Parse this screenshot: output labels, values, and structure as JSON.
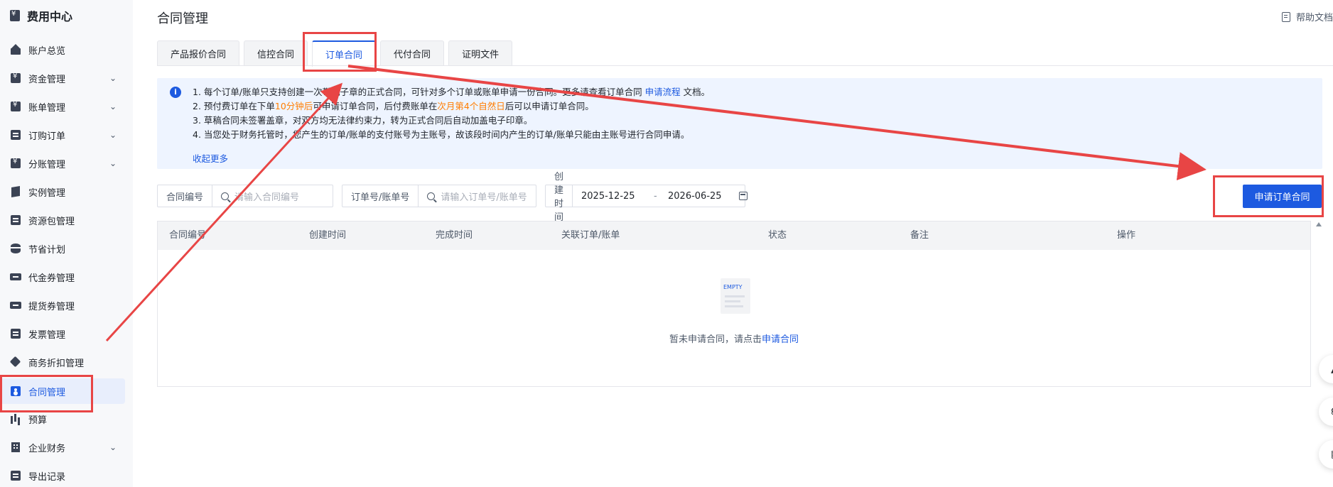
{
  "sidebar": {
    "brand": "费用中心",
    "items": [
      {
        "label": "账户总览",
        "icon": "house-icon",
        "chevron": false
      },
      {
        "label": "资金管理",
        "icon": "fund-icon",
        "chevron": true
      },
      {
        "label": "账单管理",
        "icon": "bill-icon",
        "chevron": true
      },
      {
        "label": "订购订单",
        "icon": "order-icon",
        "chevron": true
      },
      {
        "label": "分账管理",
        "icon": "split-icon",
        "chevron": true
      },
      {
        "label": "实例管理",
        "icon": "cube-icon",
        "chevron": false
      },
      {
        "label": "资源包管理",
        "icon": "package-icon",
        "chevron": false
      },
      {
        "label": "节省计划",
        "icon": "database-icon",
        "chevron": false
      },
      {
        "label": "代金券管理",
        "icon": "voucher-icon",
        "chevron": false
      },
      {
        "label": "提货券管理",
        "icon": "coupon-icon",
        "chevron": false
      },
      {
        "label": "发票管理",
        "icon": "invoice-icon",
        "chevron": false
      },
      {
        "label": "商务折扣管理",
        "icon": "tag-icon",
        "chevron": false
      },
      {
        "label": "合同管理",
        "icon": "contract-icon",
        "chevron": false,
        "active": true
      },
      {
        "label": "预算",
        "icon": "chart-icon",
        "chevron": false
      },
      {
        "label": "企业财务",
        "icon": "building-icon",
        "chevron": true
      },
      {
        "label": "导出记录",
        "icon": "export-icon",
        "chevron": false
      }
    ]
  },
  "header": {
    "title": "合同管理",
    "help": "帮助文档"
  },
  "tabs": [
    "产品报价合同",
    "信控合同",
    "订单合同",
    "代付合同",
    "证明文件"
  ],
  "notice": {
    "line1_a": "1. 每个订单/账单只支持创建一次带电子章的正式合同，可针对多个订单或账单申请一份合同。更多请查看订单合同",
    "line1_link": "申请流程",
    "line1_b": "文档。",
    "line2_a": "2. 预付费订单在下单",
    "line2_hl1": "10分钟后",
    "line2_b": "可申请订单合同，后付费账单在",
    "line2_hl2": "次月第4个自然日",
    "line2_c": "后可以申请订单合同。",
    "line3": "3. 草稿合同未签署盖章，对双方均无法律约束力，转为正式合同后自动加盖电子印章。",
    "line4": "4. 当您处于财务托管时，您产生的订单/账单的支付账号为主账号，故该段时间内产生的订单/账单只能由主账号进行合同申请。",
    "collapse": "收起更多"
  },
  "filters": {
    "contract_no_label": "合同编号",
    "contract_no_placeholder": "请输入合同编号",
    "order_no_label": "订单号/账单号",
    "order_no_placeholder": "请输入订单号/账单号",
    "date_label": "创建时间",
    "date_start": "2025-12-25",
    "date_sep": "-",
    "date_end": "2026-06-25"
  },
  "apply_button": "申请订单合同",
  "table": {
    "columns": [
      "合同编号",
      "创建时间",
      "完成时间",
      "关联订单/账单",
      "状态",
      "备注",
      "操作"
    ],
    "empty_icon_text": "EMPTY",
    "empty_text": "暂未申请合同，请点击",
    "empty_link": "申请合同"
  },
  "annotation_color": "#e84545",
  "accent_color": "#1d5ae0"
}
